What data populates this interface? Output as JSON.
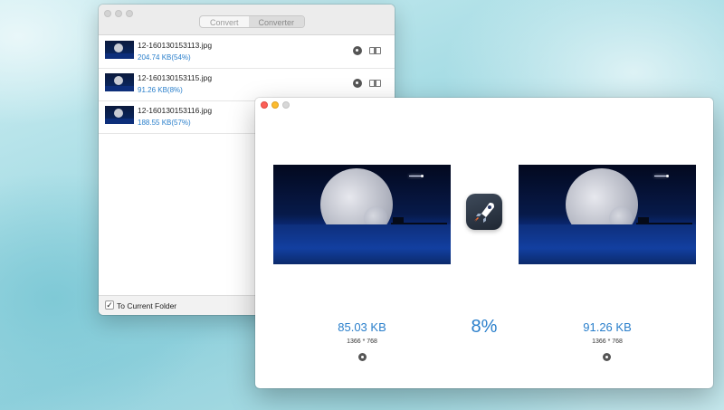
{
  "back_window": {
    "tabs": [
      "Convert",
      "Converter"
    ],
    "active_tab": 1,
    "files": [
      {
        "name": "12-160130153113.jpg",
        "size": "204.74 KB(54%)"
      },
      {
        "name": "12-160130153115.jpg",
        "size": "91.26 KB(8%)"
      },
      {
        "name": "12-160130153116.jpg",
        "size": "188.55 KB(57%)"
      }
    ],
    "footer": {
      "checkbox_checked": true,
      "checkbox_label": "To Current Folder"
    }
  },
  "front_window": {
    "original": {
      "size": "85.03 KB",
      "dimensions": "1366 * 768"
    },
    "converted": {
      "size": "91.26 KB",
      "dimensions": "1366 * 768"
    },
    "percent": "8%"
  },
  "colors": {
    "accent": "#2a7fcb",
    "close": "#fc5f57",
    "minimize": "#fdbc2e"
  },
  "icons": [
    "zoom-icon",
    "compare-icon",
    "checkmark-icon",
    "rocket-icon"
  ]
}
